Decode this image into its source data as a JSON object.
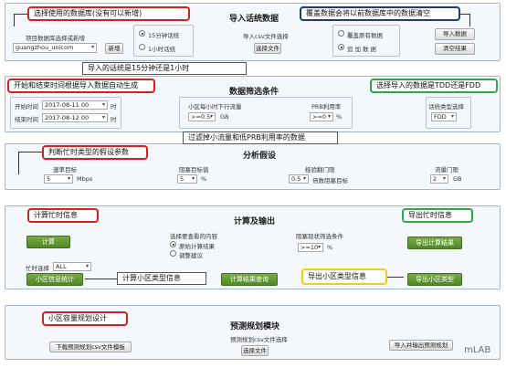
{
  "p1": {
    "title": "导入话统数据",
    "db_label": "项目数据库选择或新增",
    "db_value": "guangzhou_unicom",
    "new_btn": "新增",
    "radio_15": "15分钟话统",
    "radio_1h": "1小时话统",
    "csv_label": "导入csv文件选择",
    "select_btn": "选择文件",
    "cover_opt": "覆盖原有数据",
    "add_opt": "追加数据",
    "import_btn": "导入数据",
    "clear_btn": "清空结果"
  },
  "p2": {
    "title": "数据筛选条件",
    "start_label": "开始时间",
    "start_val": "2017-08-11 00",
    "end_label": "结束时间",
    "end_val": "2017-08-12 00",
    "hour_unit": "时",
    "flow_label": "小区每小时下行流量",
    "flow_op": ">=0.5",
    "flow_unit": "GB",
    "prb_label": "PRB利用率",
    "prb_op": ">=0",
    "prb_unit": "%",
    "type_label": "话统类型选择",
    "type_val": "FDD"
  },
  "p3": {
    "title": "分析假设",
    "rate_label": "速率目标",
    "rate_val": "5",
    "rate_unit": "Mbps",
    "block_label": "阻塞目标值",
    "block_val": "5",
    "block_unit": "%",
    "exp_label": "经验翻门限",
    "exp_val": "0.5",
    "exp_desc": "倍数阻塞目标",
    "flow_label": "流量门限",
    "flow_val": "2",
    "flow_unit": "GB"
  },
  "p4": {
    "title": "计算及输出",
    "calc_btn": "计算",
    "choose_label": "选择要查看的内容",
    "opt_original": "原始计算结果",
    "opt_adjust": "调整建议",
    "block_label": "阻塞现状筛选条件",
    "block_op": ">=10",
    "block_unit": "%",
    "export_calc_btn": "导出计算结果",
    "busy_label": "忙时选择",
    "busy_val": "ALL",
    "cell_stat_btn": "小区信息统计",
    "query_btn": "计算结果查询",
    "export_type_btn": "导出小区类型"
  },
  "p5": {
    "title": "预测规划模块",
    "download_btn": "下载预测规划csv文件模板",
    "csv_label": "预测规划csv文件选择",
    "select_btn": "选择文件",
    "import_export_btn": "导入并输出预测规划"
  },
  "callouts": {
    "c1": "选择使用的数据库(没有可以新增)",
    "c2": "覆盖数据会将以前数据库中的数据清空",
    "c3": "导入的话统是15分钟还是1小时",
    "c4": "开始和结束时间根据导入数据自动生成",
    "c5": "选择导入的数据是TDD还是FDD",
    "c6": "过滤掉小流量和低PRB利用率的数据",
    "c7": "判断忙时类型的假设参数",
    "c8": "计算忙时信息",
    "c9": "导出忙时信息",
    "c10": "计算小区类型信息",
    "c11": "导出小区类型信息",
    "c12": "小区容量规划设计"
  },
  "watermark": "mLAB"
}
